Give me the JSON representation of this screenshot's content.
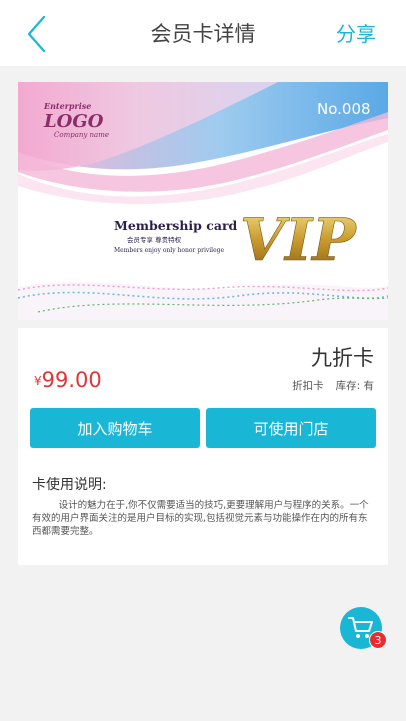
{
  "header": {
    "title": "会员卡详情",
    "share_label": "分享",
    "back_icon": "chevron-left-icon",
    "accent_color": "#19b6d6"
  },
  "card_image": {
    "number": "No.008",
    "logo_top": "Enterprise",
    "logo_main": "LOGO",
    "logo_sub": "Company name",
    "heading": "Membership card",
    "subheading": "会员专享  尊贵特权",
    "tagline": "Members enjoy only honor privilege",
    "vip": "VIP"
  },
  "product": {
    "name": "九折卡",
    "currency": "¥",
    "price": "99.00",
    "price_color": "#e0363a",
    "type": "折扣卡",
    "stock_label": "库存: 有"
  },
  "actions": {
    "add_to_cart": "加入购物车",
    "available_stores": "可使用门店"
  },
  "usage": {
    "title": "卡使用说明:",
    "text": "设计的魅力在于,你不仅需要适当的技巧,更要理解用户与程序的关系。一个有效的用户界面关注的是用户目标的实现,包括视觉元素与功能操作在内的所有东西都需要完整。"
  },
  "cart_fab": {
    "icon": "shopping-cart-icon",
    "badge": "3"
  }
}
